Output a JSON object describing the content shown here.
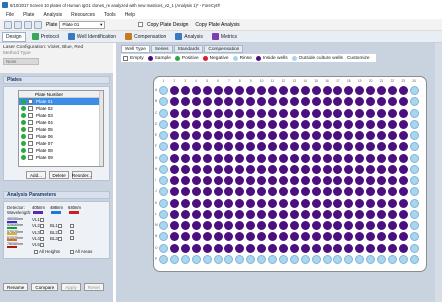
{
  "titlebar": {
    "title": "8/10/2017 Screen 10 plates of Human IgG1 clones_re analyzed with new matrices_v2_1 (Analysis 1)* - ForeCyt®"
  },
  "menu": [
    "File",
    "Plate",
    "Analysis",
    "Resources",
    "Tools",
    "Help"
  ],
  "toolbar": {
    "plate_label": "Plate",
    "plate_value": "Plate 01",
    "copy_design": "Copy Plate Design",
    "copy_analysis": "Copy Plate Analysis"
  },
  "ribbon_tabs": [
    "Design",
    "Protocol",
    "Well Identification",
    "Compensation",
    "Analysis",
    "Metrics"
  ],
  "left_panel": {
    "laser_line": "Laser Configuration: Violet, Blue, Red",
    "method_type": "Method Type",
    "field_value": "None"
  },
  "plates": {
    "header": "Plates",
    "column": "Plate Number",
    "items": [
      "Plate 01",
      "Plate 02",
      "Plate 03",
      "Plate 04",
      "Plate 05",
      "Plate 06",
      "Plate 07",
      "Plate 08",
      "Plate 09"
    ],
    "add": "Add...",
    "delete": "Delete",
    "reorder": "Reorder..."
  },
  "analysis_params": {
    "header": "Analysis Parameters",
    "detector_label": "Detector:",
    "wavelength_label": "Wavelength:",
    "detectors": [
      "405nm",
      "488nm",
      "640nm"
    ],
    "vl_labels": [
      "VL1",
      "VL2",
      "VL3",
      "VL4",
      "VL5"
    ],
    "bl_labels": [
      "BL1",
      "BL2",
      "BL3"
    ],
    "fluor_labels": [
      "450/50nm",
      "525/50nm",
      "575/25nm",
      "610/20nm",
      "780/60nm"
    ],
    "all_heights": "All Heights",
    "all_areas": "All Areas",
    "rename": "Rename",
    "compare": "Compare",
    "apply": "Apply",
    "reset": "Reset"
  },
  "subtabs": [
    "Well Type",
    "Series",
    "Standards",
    "Compensation"
  ],
  "legend": {
    "empty": "Empty",
    "sample": "Sample",
    "positive": "Positive",
    "negative": "Negative",
    "rinse": "Rinse",
    "inside": "Inside wells",
    "outside": "Outside culture wells",
    "customize": "Customize"
  },
  "plate": {
    "columns": [
      "1",
      "2",
      "3",
      "4",
      "5",
      "6",
      "7",
      "8",
      "9",
      "10",
      "11",
      "12",
      "13",
      "14",
      "15",
      "16",
      "17",
      "18",
      "19",
      "20",
      "21",
      "22",
      "23",
      "24"
    ],
    "rows": [
      "A",
      "B",
      "C",
      "D",
      "E",
      "F",
      "G",
      "H",
      "I",
      "J",
      "K",
      "L",
      "M",
      "N",
      "O",
      "P"
    ],
    "colors": {
      "sample": "#4b0f80",
      "rinse": "#a9d5ef",
      "empty": "#ffffff"
    },
    "rinse_columns": [
      1,
      24
    ],
    "rinse_rows": [
      "P"
    ]
  }
}
